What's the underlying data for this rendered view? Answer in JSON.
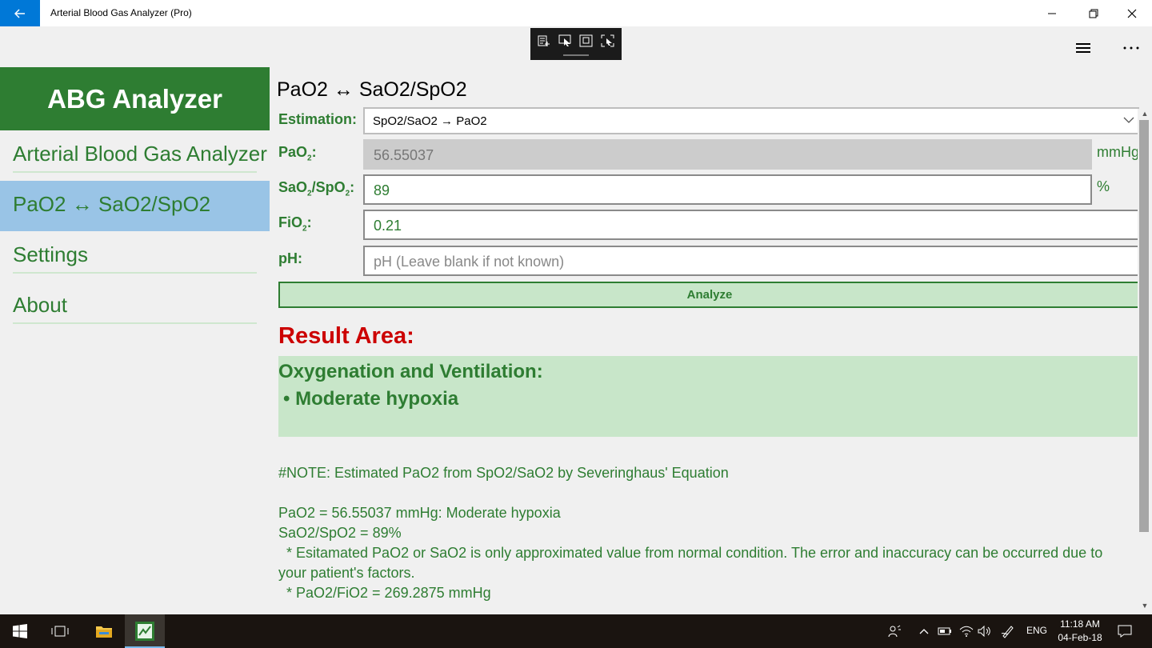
{
  "window": {
    "title": "Arterial Blood Gas Analyzer (Pro)"
  },
  "sidebar": {
    "brand": "ABG Analyzer",
    "items": [
      {
        "label": "Arterial Blood Gas Analyzer",
        "active": false
      },
      {
        "label": "PaO2 ↔ SaO2/SpO2",
        "active": true
      },
      {
        "label": "Settings",
        "active": false
      },
      {
        "label": "About",
        "active": false
      }
    ]
  },
  "main": {
    "title": "PaO2 ↔ SaO2/SpO2",
    "estimation": {
      "label": "Estimation:",
      "selected": "SpO2/SaO2 → PaO2"
    },
    "pao2": {
      "label_main": "PaO",
      "label_sub": "2",
      "label_end": ":",
      "value": "56.55037",
      "unit": "mmHg"
    },
    "sao2": {
      "label_a": "SaO",
      "label_a_sub": "2",
      "label_b": "/SpO",
      "label_b_sub": "2",
      "label_end": ":",
      "value": "89",
      "unit": "%"
    },
    "fio2": {
      "label_main": "FiO",
      "label_sub": "2",
      "label_end": ":",
      "value": "0.21"
    },
    "ph": {
      "label": "pH:",
      "placeholder": "pH (Leave blank if not known)"
    },
    "analyze_label": "Analyze",
    "result_heading": "Result Area:",
    "result_line1": "Oxygenation and Ventilation:",
    "result_line2": " • Moderate hypoxia",
    "notes": {
      "line1": "#NOTE: Estimated PaO2 from SpO2/SaO2 by Severinghaus' Equation",
      "line2": "PaO2  = 56.55037 mmHg: Moderate hypoxia",
      "line3": "SaO2/SpO2 = 89%",
      "line4": "  * Esitamated PaO2 or SaO2 is only approximated value from normal condition. The error and inaccuracy can be occurred due to",
      "line5": "your patient's factors.",
      "line6": "  * PaO2/FiO2 = 269.2875 mmHg"
    }
  },
  "taskbar": {
    "lang": "ENG",
    "time": "11:18 AM",
    "date": "04-Feb-18"
  },
  "colors": {
    "brand_green": "#2e7d32",
    "active_nav": "#99c4e6",
    "result_bg": "#c8e6c9",
    "result_heading": "#cc0000",
    "titlebar_accent": "#0078d7"
  }
}
